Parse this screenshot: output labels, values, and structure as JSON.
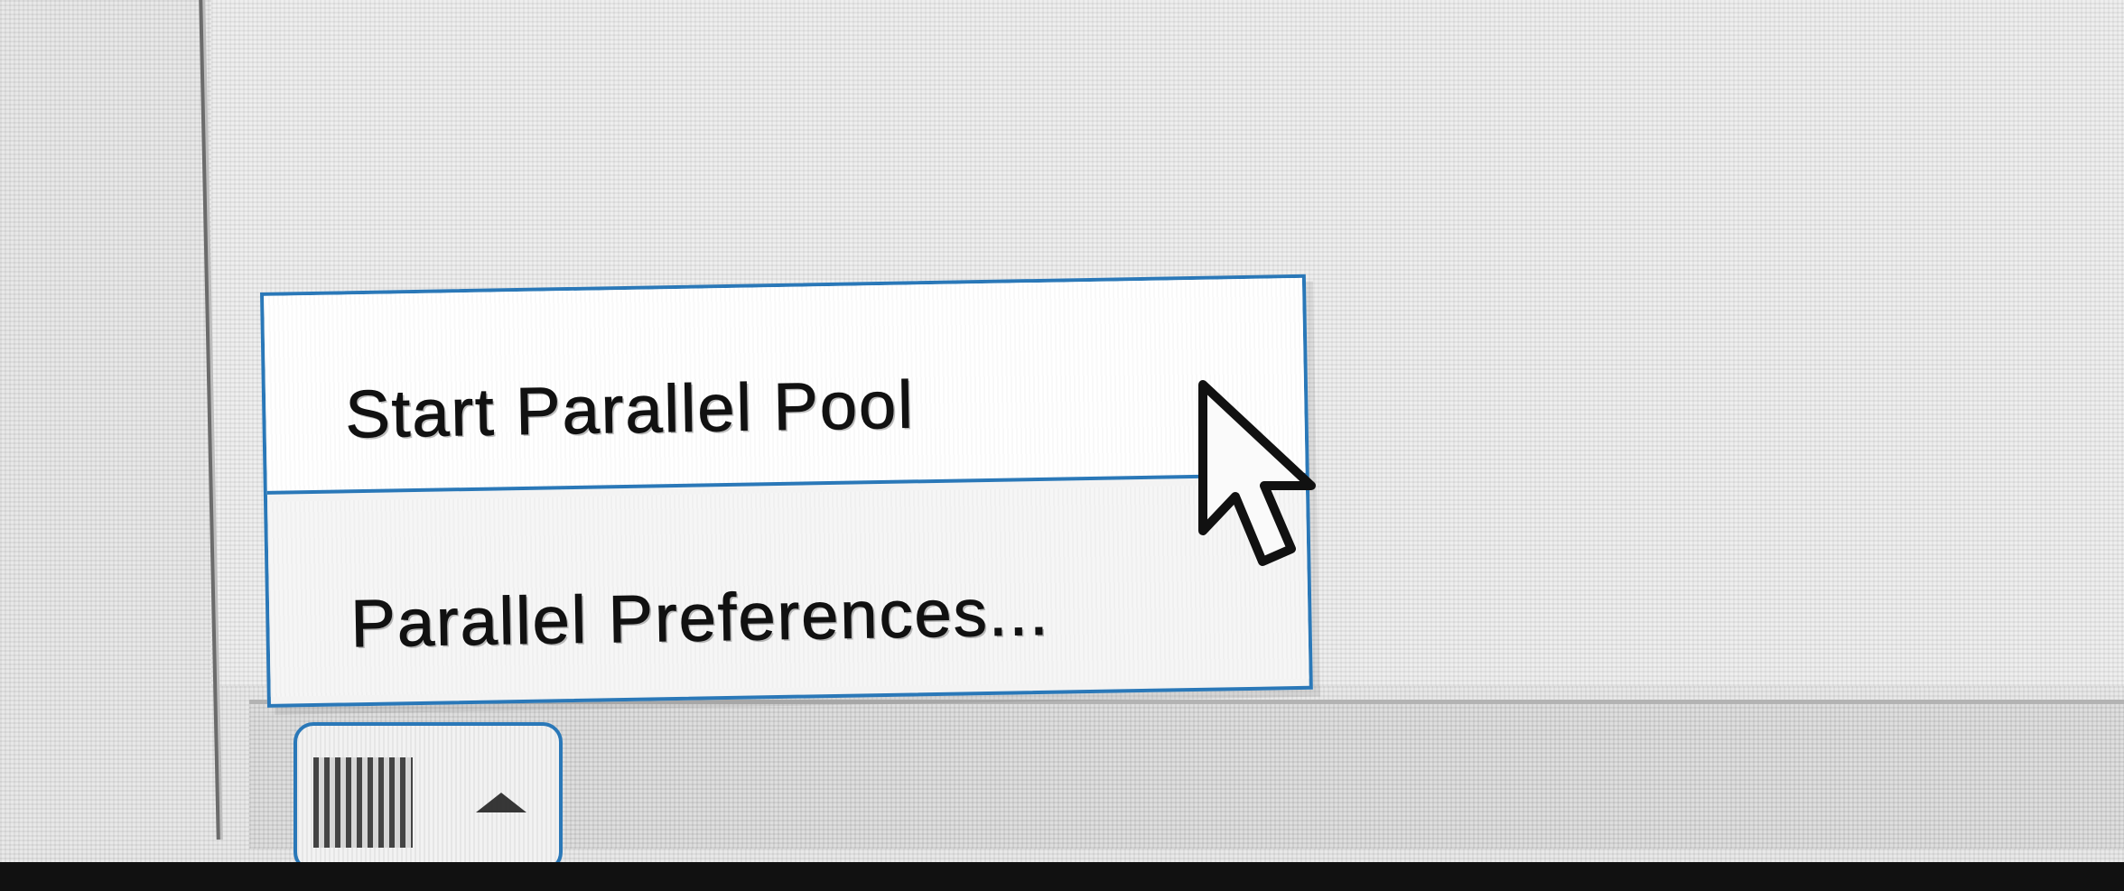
{
  "menu": {
    "items": [
      {
        "label": "Start Parallel Pool",
        "state": "hovered"
      },
      {
        "label": "Parallel Preferences..."
      }
    ]
  },
  "status_widget": {
    "icon": "parallel-status-bars-icon",
    "arrow": "up-arrow-icon"
  },
  "colors": {
    "accent": "#2a78b8",
    "menu_background": "#f3f3f3",
    "text": "#111111"
  }
}
